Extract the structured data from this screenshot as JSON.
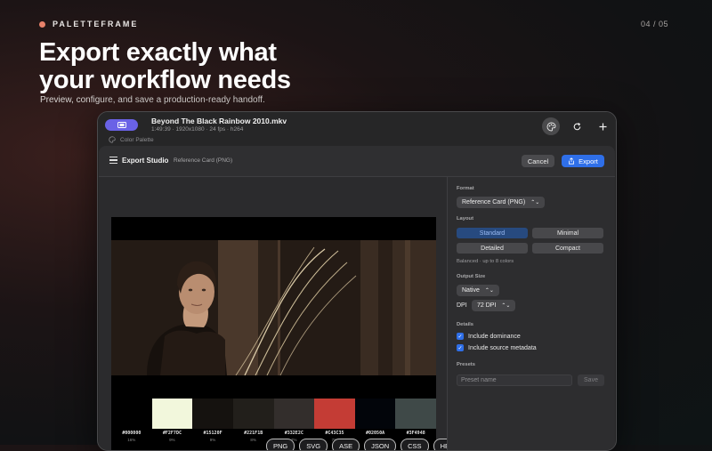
{
  "brand": {
    "name": "PALETTEFRAME",
    "dot_color": "#e8826a"
  },
  "pager": "04 / 05",
  "hero": {
    "headline_line1": "Export exactly what",
    "headline_line2": "your workflow needs",
    "subline": "Preview, configure, and save a production-ready handoff."
  },
  "window": {
    "file_title": "Beyond The Black Rainbow 2010.mkv",
    "file_meta": "1:49:39 · 1920x1080 · 24 fps · h264",
    "sub_label": "Color Palette",
    "toolbar_icons": [
      "palette-icon",
      "refresh-icon",
      "plus-icon"
    ]
  },
  "sheet": {
    "title": "Export Studio",
    "subtitle": "Reference Card (PNG)",
    "cancel_label": "Cancel",
    "export_label": "Export"
  },
  "palette": [
    {
      "hex": "#000000",
      "pct": "16%",
      "color": "#000000"
    },
    {
      "hex": "#F2F7DC",
      "pct": "9%",
      "color": "#F2F7DC"
    },
    {
      "hex": "#15120F",
      "pct": "9%",
      "color": "#15120F"
    },
    {
      "hex": "#221F1B",
      "pct": "8%",
      "color": "#221F1B"
    },
    {
      "hex": "#332E2C",
      "pct": "7%",
      "color": "#332E2C"
    },
    {
      "hex": "#C43C35",
      "pct": "7%",
      "color": "#C43C35"
    },
    {
      "hex": "#02050A",
      "pct": "7%",
      "color": "#02050A"
    },
    {
      "hex": "#3F4948",
      "pct": "5%",
      "color": "#3F4948"
    }
  ],
  "formats": [
    "PNG",
    "SVG",
    "ASE",
    "JSON",
    "CSS",
    "HEX"
  ],
  "panel": {
    "format_label": "Format",
    "format_value": "Reference Card (PNG)",
    "layout_label": "Layout",
    "layouts": [
      "Standard",
      "Minimal",
      "Detailed",
      "Compact"
    ],
    "selected_layout": "Standard",
    "layout_hint": "Balanced · up to 8 colors",
    "output_label": "Output Size",
    "output_value": "Native",
    "dpi_label": "DPI",
    "dpi_value": "72 DPI",
    "details_label": "Details",
    "check_dominance": "Include dominance",
    "check_metadata": "Include source metadata",
    "presets_label": "Presets",
    "preset_placeholder": "Preset name",
    "save_label": "Save"
  },
  "colors": {
    "accent": "#2f6fe8",
    "file_pill": "#6a62e6",
    "selected_segment": "#274a7f"
  }
}
